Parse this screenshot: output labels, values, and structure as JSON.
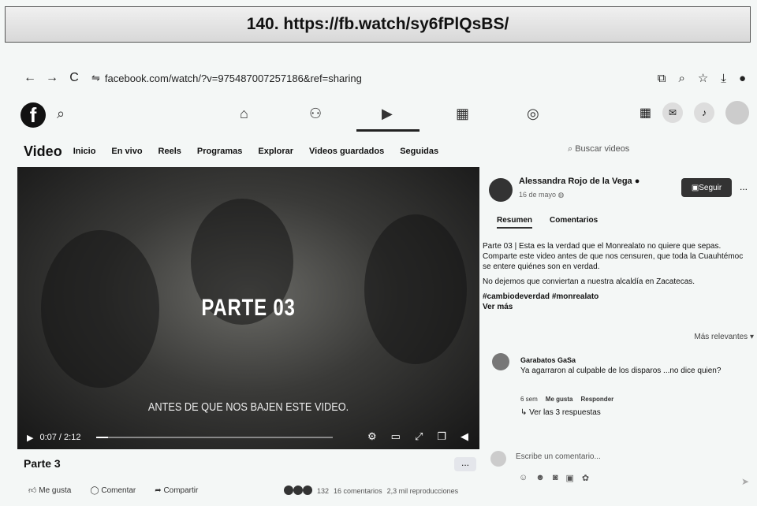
{
  "banner": {
    "text": "140. https://fb.watch/sy6fPlQsBS/"
  },
  "browser": {
    "url": "facebook.com/watch/?v=975487007257186&ref=sharing",
    "back": "←",
    "forward": "→",
    "reload": "C"
  },
  "fbnav": {
    "logo": "f"
  },
  "subnav": {
    "title": "Video",
    "items": [
      "Inicio",
      "En vivo",
      "Reels",
      "Programas",
      "Explorar",
      "Videos guardados",
      "Seguidas"
    ],
    "search_placeholder": "Buscar videos"
  },
  "video": {
    "overlay_title": "PARTE 03",
    "overlay_subtitle": "ANTES DE QUE NOS BAJEN ESTE VIDEO.",
    "time": "0:07 / 2:12",
    "progress": 0.05,
    "title": "Parte 3",
    "more": "..."
  },
  "actions": {
    "like": "Me gusta",
    "comment": "Comentar",
    "share": "Compartir"
  },
  "stats": {
    "reactions": "132",
    "comments": "16 comentarios",
    "views": "2,3 mil reproducciones"
  },
  "post": {
    "author": "Alessandra Rojo de la Vega",
    "date": "16 de mayo",
    "follow": "Seguir",
    "more": "...",
    "tabs": [
      "Resumen",
      "Comentarios"
    ],
    "paragraph1": "Parte 03 | Esta es la verdad que el Monrealato no quiere que sepas. Comparte este video antes de que nos censuren, que toda la Cuauhtémoc se entere quiénes son en verdad.",
    "paragraph2": "No dejemos que conviertan a nuestra alcaldía en Zacatecas.",
    "hashtags": "#cambiodeverdad #monrealato",
    "see_more": "Ver más"
  },
  "comments": {
    "sort": "Más relevantes",
    "items": [
      {
        "name": "Garabatos GaSa",
        "text": "Ya agarraron al culpable de los disparos ...no dice quien?",
        "time": "6 sem",
        "like": "Me gusta",
        "reply": "Responder",
        "replies": "Ver las 3 respuestas"
      }
    ],
    "write_placeholder": "Escribe un comentario..."
  }
}
